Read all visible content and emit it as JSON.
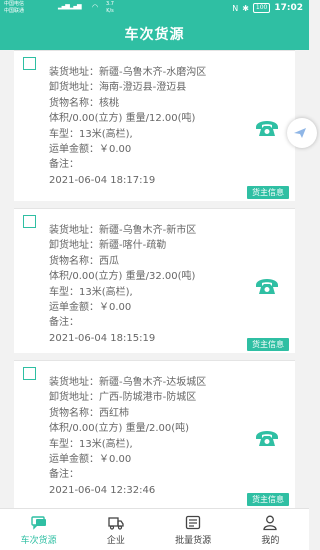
{
  "status_bar": {
    "carrier1": "中国电信",
    "carrier2": "中国联通",
    "speed": "3.7",
    "speed_unit": "K/s",
    "battery": "100",
    "time": "17:02"
  },
  "header": {
    "title": "车次货源"
  },
  "labels": {
    "load": "装货地址：",
    "unload": "卸货地址：",
    "cargo": "货物名称：",
    "volume": "体积/",
    "weight": "重量/",
    "truck": "车型：",
    "fee": "运单金额：",
    "note": "备注：",
    "cargo_owner_button": "货主信息"
  },
  "cards": [
    {
      "load_address": "新疆-乌鲁木齐-水磨沟区",
      "unload_address": "海南-澄迈县-澄迈县",
      "cargo_name": "核桃",
      "volume_weight": "0.00(立方)  重量/12.00(吨)",
      "truck_type": "13米(高栏),",
      "fee": "￥0.00",
      "note": "",
      "datetime": "2021-06-04 18:17:19"
    },
    {
      "load_address": "新疆-乌鲁木齐-新市区",
      "unload_address": "新疆-喀什-疏勒",
      "cargo_name": "西瓜",
      "volume_weight": "0.00(立方)  重量/32.00(吨)",
      "truck_type": "13米(高栏),",
      "fee": "￥0.00",
      "note": "",
      "datetime": "2021-06-04 18:15:19"
    },
    {
      "load_address": "新疆-乌鲁木齐-达坂城区",
      "unload_address": "广西-防城港市-防城区",
      "cargo_name": "西红柿",
      "volume_weight": "0.00(立方)  重量/2.00(吨)",
      "truck_type": "13米(高栏),",
      "fee": "￥0.00",
      "note": "",
      "datetime": "2021-06-04 12:32:46"
    }
  ],
  "tabs": [
    {
      "label": "车次货源",
      "icon": "chat-truck-icon",
      "active": true
    },
    {
      "label": "企业",
      "icon": "truck-icon",
      "active": false
    },
    {
      "label": "批量货源",
      "icon": "list-icon",
      "active": false
    },
    {
      "label": "我的",
      "icon": "person-icon",
      "active": false
    }
  ],
  "colors": {
    "primary": "#2fbfa3",
    "text": "#666666"
  }
}
